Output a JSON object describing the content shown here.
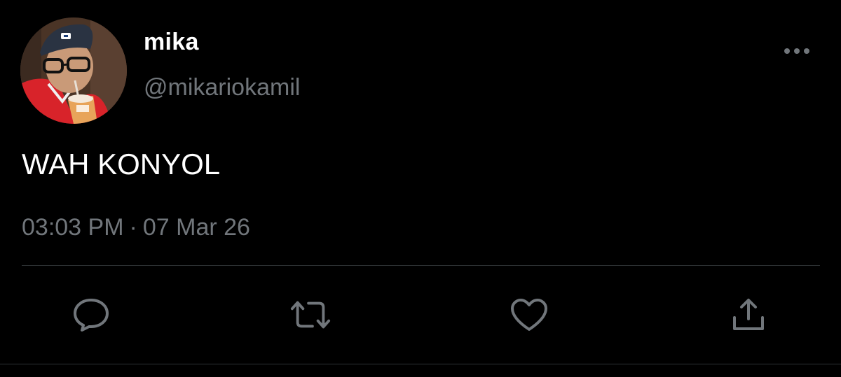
{
  "user": {
    "display_name": "mika",
    "handle": "@mikariokamil",
    "avatar_icon": "profile-photo"
  },
  "tweet": {
    "text": "WAH KONYOL",
    "time": "03:03 PM",
    "separator": "·",
    "date": "07 Mar 26"
  },
  "actions": {
    "reply_icon": "reply-icon",
    "retweet_icon": "retweet-icon",
    "like_icon": "heart-icon",
    "share_icon": "share-icon"
  },
  "colors": {
    "background": "#000000",
    "primary_text": "#ffffff",
    "secondary_text": "#71767b",
    "divider": "#2f3336",
    "icon": "#71767b"
  }
}
